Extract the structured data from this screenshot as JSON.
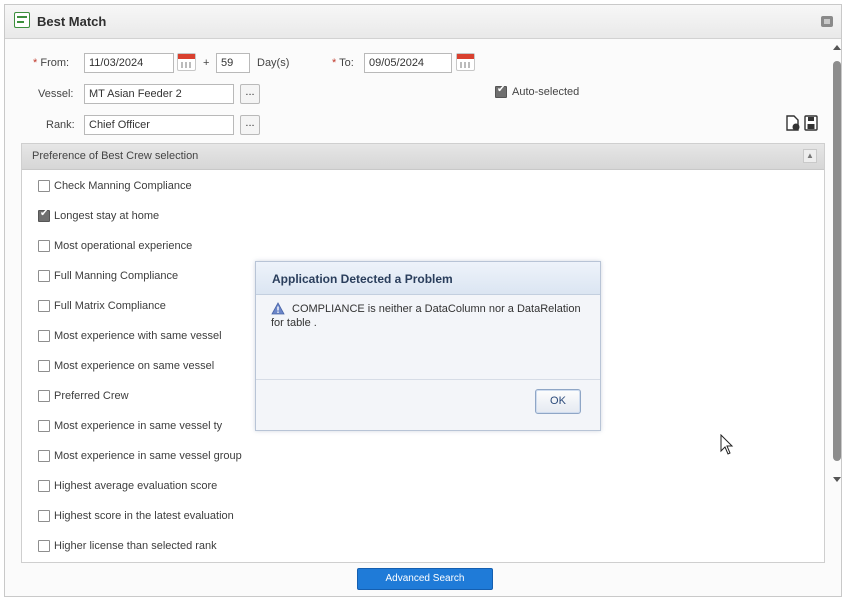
{
  "window": {
    "title": "Best Match"
  },
  "filters": {
    "from_label": "From:",
    "from_value": "11/03/2024",
    "days_separator": "+",
    "days_value": "59",
    "days_unit": "Day(s)",
    "to_label": "To:",
    "to_value": "09/05/2024",
    "vessel_label": "Vessel:",
    "vessel_value": "MT Asian Feeder 2",
    "rank_label": "Rank:",
    "rank_value": "Chief Officer",
    "ellipsis_label": "...",
    "auto_selected_label": "Auto-selected",
    "auto_selected_checked": true
  },
  "preferences": {
    "header": "Preference of Best Crew selection",
    "items": [
      {
        "label": "Check Manning Compliance",
        "checked": false
      },
      {
        "label": "Longest stay at home",
        "checked": true
      },
      {
        "label": "Most operational experience",
        "checked": false
      },
      {
        "label": "Full Manning Compliance",
        "checked": false
      },
      {
        "label": "Full Matrix Compliance",
        "checked": false
      },
      {
        "label": "Most experience with same vessel",
        "checked": false
      },
      {
        "label": "Most experience on same vessel",
        "checked": false
      },
      {
        "label": "Preferred Crew",
        "checked": false
      },
      {
        "label": "Most experience in same vessel ty",
        "checked": false
      },
      {
        "label": "Most experience in same vessel group",
        "checked": false
      },
      {
        "label": "Highest average evaluation score",
        "checked": false
      },
      {
        "label": "Highest score in the latest evaluation",
        "checked": false
      },
      {
        "label": "Higher license than selected rank",
        "checked": false
      }
    ]
  },
  "actions": {
    "advanced_search_label": "Advanced Search"
  },
  "dialog": {
    "title": "Application Detected a Problem",
    "message": "COMPLIANCE is neither a DataColumn nor a DataRelation for table .",
    "ok_label": "OK"
  },
  "colors": {
    "accent_button": "#1f7bd8",
    "calendar_icon": "#d9402f",
    "title_icon": "#3d8f3d",
    "dialog_header": "#dbe5f2"
  },
  "icons": [
    "calendar-icon",
    "export-icon",
    "save-icon",
    "warning-icon",
    "collapse-icon",
    "mouse-cursor-icon"
  ]
}
